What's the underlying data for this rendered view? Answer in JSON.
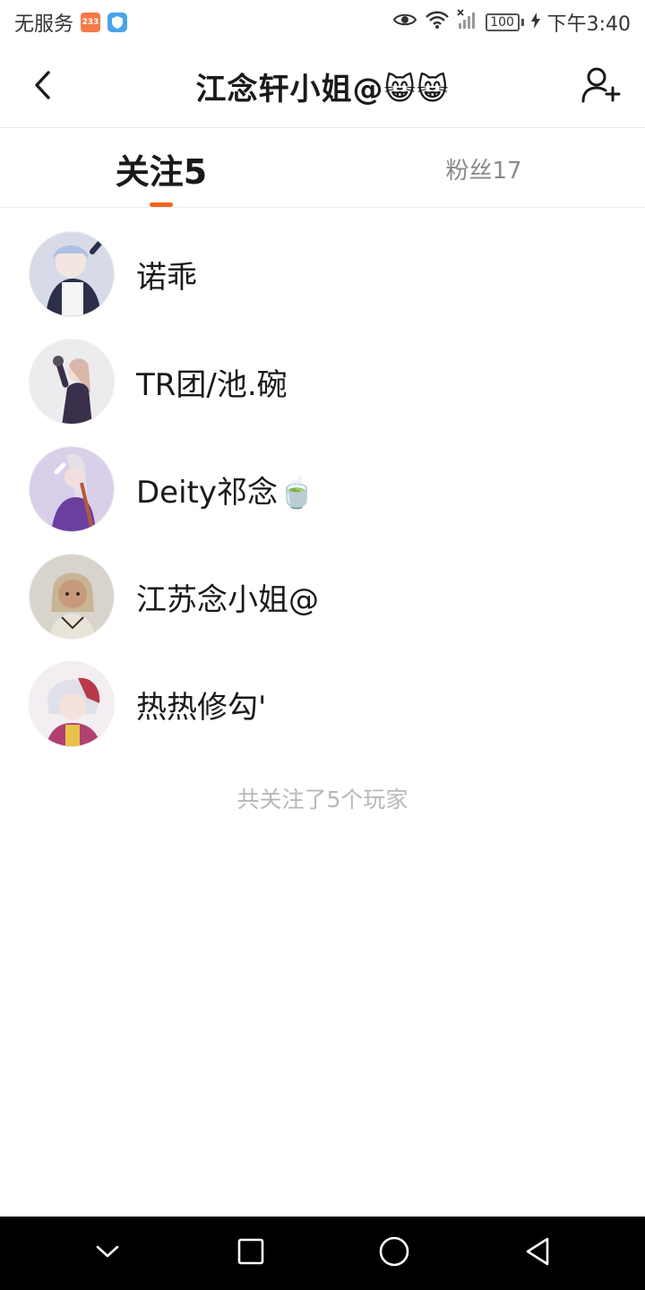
{
  "status_bar": {
    "carrier": "无服务",
    "app_badge": "233",
    "battery": "100",
    "time": "下午3:40"
  },
  "header": {
    "title": "江念轩小姐@😸😸"
  },
  "tabs": [
    {
      "label": "关注5",
      "active": true
    },
    {
      "label": "粉丝17",
      "active": false
    }
  ],
  "following": [
    {
      "name": "诺乖",
      "avatar_colors": [
        "#d7dbe8",
        "#3b3f63"
      ]
    },
    {
      "name": "TR团/池.碗",
      "avatar_colors": [
        "#ececef",
        "#3a2f4a"
      ]
    },
    {
      "name": "Deity祁念🍵",
      "avatar_colors": [
        "#d9cfe8",
        "#6b3fa0"
      ]
    },
    {
      "name": "江苏念小姐@",
      "avatar_colors": [
        "#d8d4cc",
        "#7a6a55"
      ]
    },
    {
      "name": "热热修勾'",
      "avatar_colors": [
        "#f3eef2",
        "#b04070"
      ]
    }
  ],
  "footer_note": "共关注了5个玩家",
  "colors": {
    "accent": "#f0641e",
    "inactive_tab": "#8a8a8a",
    "footer_text": "#b8b8b8"
  },
  "icons": {
    "back": "chevron-left-icon",
    "add_user": "add-user-icon",
    "nav_back": "triangle-back-icon",
    "nav_home": "circle-home-icon",
    "nav_recent": "square-recent-icon",
    "nav_hide": "chevron-down-icon"
  }
}
